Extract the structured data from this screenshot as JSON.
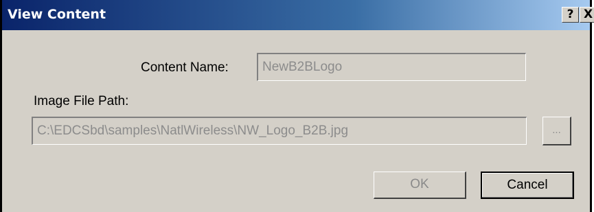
{
  "window": {
    "title": "View Content",
    "help_label": "?",
    "close_label": "X"
  },
  "content_name": {
    "label": "Content Name:",
    "value": "NewB2BLogo"
  },
  "image_path": {
    "label": "Image File Path:",
    "value": "C:\\EDCSbd\\samples\\NatlWireless\\NW_Logo_B2B.jpg",
    "browse_label": "..."
  },
  "buttons": {
    "ok_label": "OK",
    "cancel_label": "Cancel"
  }
}
